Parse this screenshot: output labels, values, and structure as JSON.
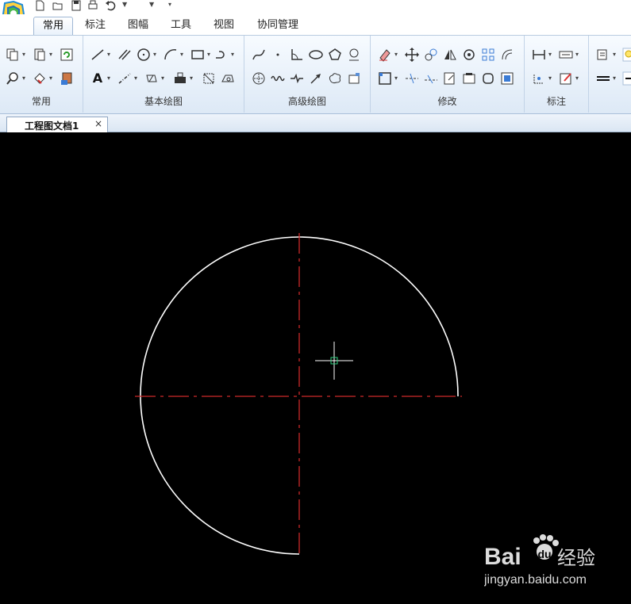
{
  "ribbon_tabs": [
    {
      "label": "常用",
      "active": true
    },
    {
      "label": "标注"
    },
    {
      "label": "图幅"
    },
    {
      "label": "工具"
    },
    {
      "label": "视图"
    },
    {
      "label": "协同管理"
    }
  ],
  "groups": {
    "common": "常用",
    "basic_draw": "基本绘图",
    "advanced_draw": "高级绘图",
    "modify": "修改",
    "annotate": "标注"
  },
  "document_tab": {
    "title": "工程图文档1",
    "close_glyph": "×"
  },
  "toolbar_glyphs": {
    "text": "A"
  },
  "watermark": {
    "brand": "Bai",
    "paw": "du",
    "suffix": "经验",
    "url": "jingyan.baidu.com"
  },
  "colors": {
    "centerline": "#cc2a2a",
    "geometry": "#ffffff",
    "cursor_box": "#30d080",
    "canvas": "#000000"
  }
}
